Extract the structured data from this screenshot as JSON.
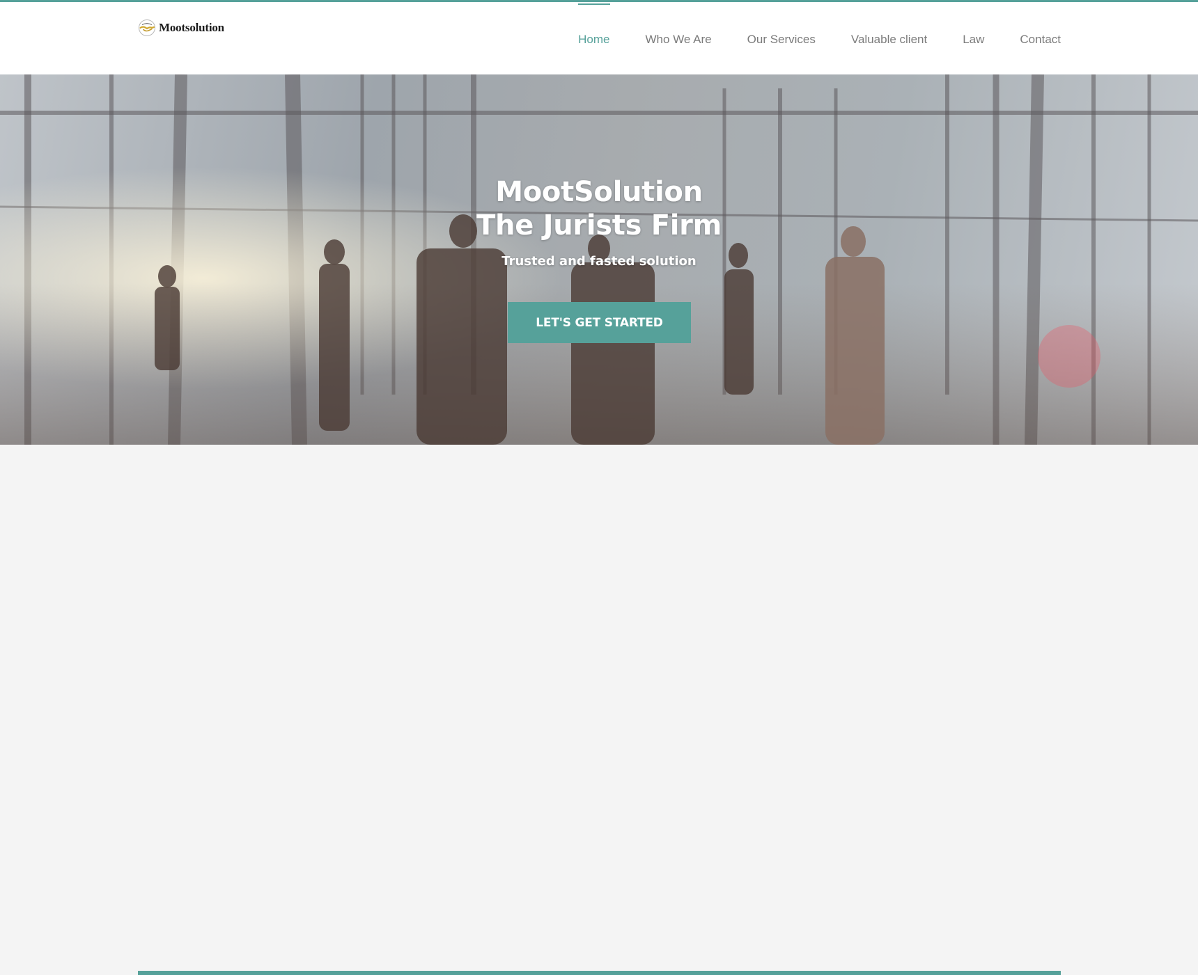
{
  "brand": {
    "name": "Mootsolution",
    "logo_icon": "handshake-seal-icon"
  },
  "nav": {
    "items": [
      {
        "label": "Home",
        "active": true
      },
      {
        "label": "Who We Are",
        "active": false
      },
      {
        "label": "Our Services",
        "active": false
      },
      {
        "label": "Valuable client",
        "active": false
      },
      {
        "label": "Law",
        "active": false
      },
      {
        "label": "Contact",
        "active": false
      }
    ]
  },
  "hero": {
    "title_line1": "MootSolution",
    "title_line2": "The Jurists Firm",
    "subtitle": "Trusted and fasted solution",
    "cta_label": "LET'S GET STARTED"
  },
  "colors": {
    "accent": "#56a19a",
    "nav_text": "#7b7b7b",
    "background": "#f4f4f4"
  }
}
